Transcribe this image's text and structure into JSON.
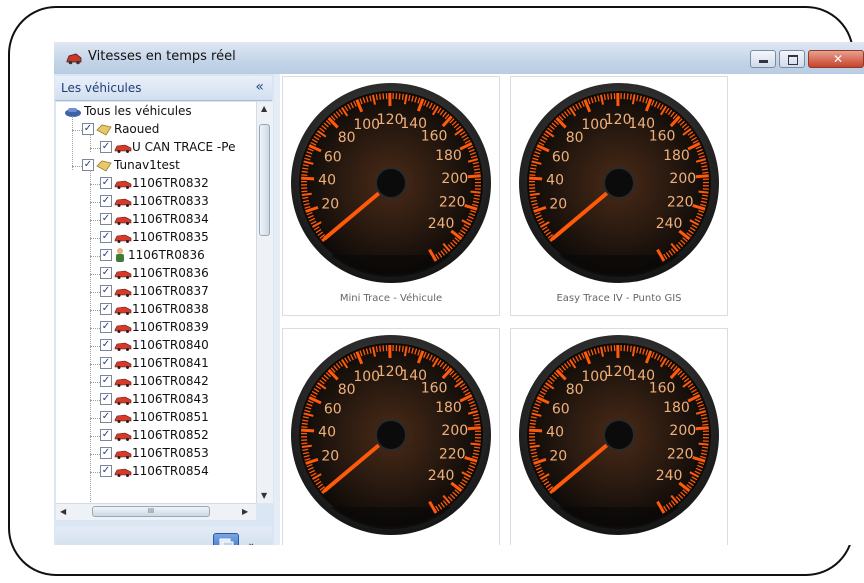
{
  "window": {
    "title": "Vitesses en temps réel"
  },
  "sidebar": {
    "title": "Les véhicules",
    "collapse_glyph": "«",
    "scroll_thumb_grip": "III",
    "tree": [
      {
        "label": "Tous les véhicules",
        "level": 0,
        "checkbox": false,
        "icon": "fleet-icon"
      },
      {
        "label": "Raoued",
        "level": 1,
        "checkbox": true,
        "icon": "group-icon"
      },
      {
        "label": "U CAN TRACE -Pe",
        "level": 2,
        "checkbox": true,
        "icon": "car-icon"
      },
      {
        "label": "Tunav1test",
        "level": 1,
        "checkbox": true,
        "icon": "group-icon"
      },
      {
        "label": "1106TR0832",
        "level": 2,
        "checkbox": true,
        "icon": "car-icon"
      },
      {
        "label": "1106TR0833",
        "level": 2,
        "checkbox": true,
        "icon": "car-icon"
      },
      {
        "label": "1106TR0834",
        "level": 2,
        "checkbox": true,
        "icon": "car-icon"
      },
      {
        "label": "1106TR0835",
        "level": 2,
        "checkbox": true,
        "icon": "car-icon"
      },
      {
        "label": "1106TR0836",
        "level": 2,
        "checkbox": true,
        "icon": "person-icon"
      },
      {
        "label": "1106TR0836",
        "level": 2,
        "checkbox": true,
        "icon": "car-icon"
      },
      {
        "label": "1106TR0837",
        "level": 2,
        "checkbox": true,
        "icon": "car-icon"
      },
      {
        "label": "1106TR0838",
        "level": 2,
        "checkbox": true,
        "icon": "car-icon"
      },
      {
        "label": "1106TR0839",
        "level": 2,
        "checkbox": true,
        "icon": "car-icon"
      },
      {
        "label": "1106TR0840",
        "level": 2,
        "checkbox": true,
        "icon": "car-icon"
      },
      {
        "label": "1106TR0841",
        "level": 2,
        "checkbox": true,
        "icon": "car-icon"
      },
      {
        "label": "1106TR0842",
        "level": 2,
        "checkbox": true,
        "icon": "car-icon"
      },
      {
        "label": "1106TR0843",
        "level": 2,
        "checkbox": true,
        "icon": "car-icon"
      },
      {
        "label": "1106TR0851",
        "level": 2,
        "checkbox": true,
        "icon": "car-icon"
      },
      {
        "label": "1106TR0852",
        "level": 2,
        "checkbox": true,
        "icon": "car-icon"
      },
      {
        "label": "1106TR0853",
        "level": 2,
        "checkbox": true,
        "icon": "car-icon"
      },
      {
        "label": "1106TR0854",
        "level": 2,
        "checkbox": true,
        "icon": "car-icon"
      }
    ]
  },
  "gauges": [
    {
      "caption": "Mini Trace - Véhicule",
      "speed": 0
    },
    {
      "caption": "Easy Trace IV - Punto GIS",
      "speed": 0
    },
    {
      "caption": "",
      "speed": 0
    },
    {
      "caption": "",
      "speed": 0
    }
  ],
  "gauge_scale": {
    "min": 0,
    "max": 260,
    "labels": [
      20,
      40,
      60,
      80,
      100,
      120,
      140,
      160,
      180,
      200,
      220,
      240
    ]
  },
  "colors": {
    "accent": "#ff5a0a",
    "dial_dark": "#1a1410",
    "header_text": "#1d3d78"
  }
}
